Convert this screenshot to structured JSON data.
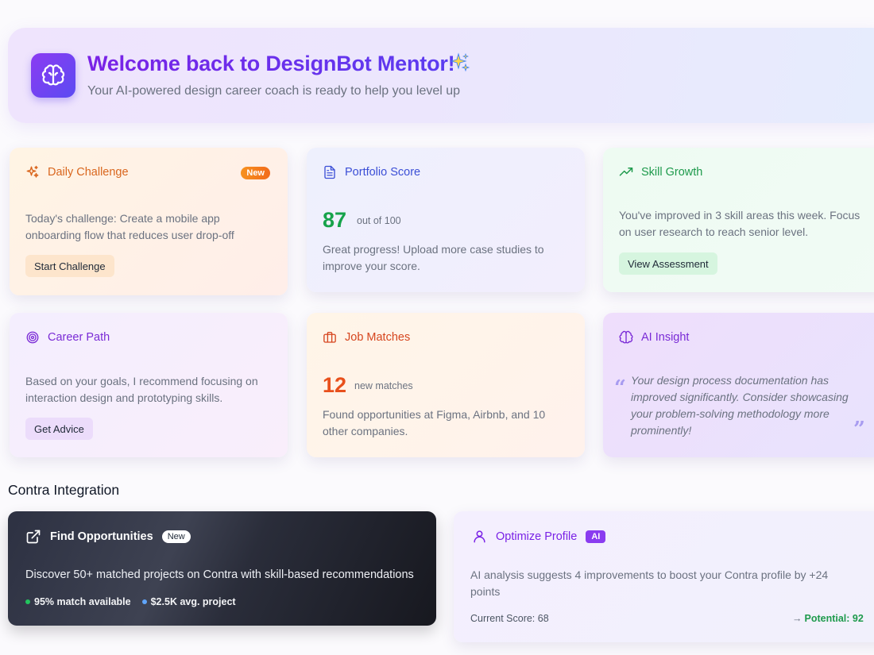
{
  "hero": {
    "title": "Welcome back to DesignBot Mentor!",
    "subtitle": "Your AI-powered design career coach is ready to help you level up",
    "brand_gradient": [
      "#8b3bf2",
      "#5b4bf2"
    ]
  },
  "cards": {
    "daily": {
      "title": "Daily Challenge",
      "badge": "New",
      "text": "Today's challenge: Create a mobile app onboarding flow that reduces user drop-off",
      "button": "Start Challenge",
      "icon": "sparkles-icon"
    },
    "portfolio": {
      "title": "Portfolio Score",
      "score": "87",
      "score_suffix": "out of 100",
      "text": "Great progress! Upload more case studies to improve your score.",
      "icon": "document-icon",
      "score_color": "#16a34a"
    },
    "skill": {
      "title": "Skill Growth",
      "text": "You've improved in 3 skill areas this week. Focus on user research to reach senior level.",
      "button": "View Assessment",
      "icon": "trending-up-icon"
    },
    "career": {
      "title": "Career Path",
      "text": "Based on your goals, I recommend focusing on interaction design and prototyping skills.",
      "button": "Get Advice",
      "icon": "target-icon"
    },
    "jobs": {
      "title": "Job Matches",
      "count": "12",
      "count_suffix": "new matches",
      "text": "Found opportunities at Figma, Airbnb, and 10 other companies.",
      "icon": "briefcase-icon",
      "count_color": "#e8501c"
    },
    "insight": {
      "title": "AI Insight",
      "quote_open": "“",
      "quote_close": "”",
      "text": "Your design process documentation has improved significantly. Consider showcasing your problem-solving methodology more prominently!",
      "icon": "brain-icon"
    }
  },
  "contra": {
    "section_title": "Contra Integration",
    "find": {
      "title": "Find Opportunities",
      "badge": "New",
      "text": "Discover 50+ matched projects on Contra with skill-based recommendations",
      "stat_match": "95% match available",
      "stat_price": "$2.5K avg. project",
      "stat_match_color": "#22c55e",
      "stat_price_color": "#60a5fa",
      "icon": "external-link-icon"
    },
    "optimize": {
      "title": "Optimize Profile",
      "badge": "AI",
      "text": "AI analysis suggests 4 improvements to boost your Contra profile by +24 points",
      "current_score": "Current Score: 68",
      "potential_arrow": "→",
      "potential": "Potential: 92",
      "icon": "user-icon"
    }
  }
}
